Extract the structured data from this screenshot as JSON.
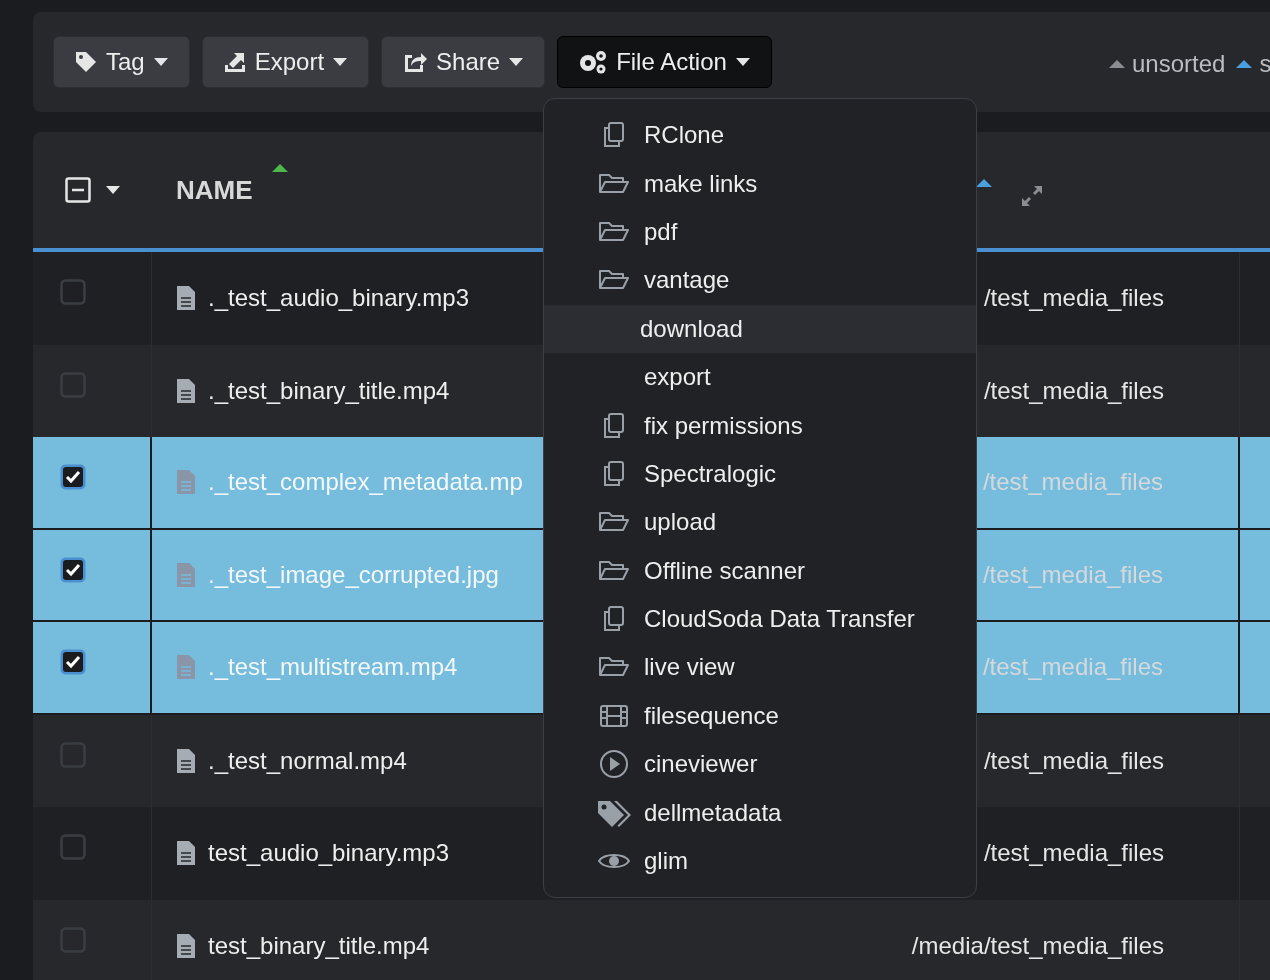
{
  "toolbar": {
    "buttons": [
      {
        "kind": "tag",
        "label": "Tag",
        "open": false
      },
      {
        "kind": "export",
        "label": "Export",
        "open": false
      },
      {
        "kind": "share",
        "label": "Share",
        "open": false
      },
      {
        "kind": "gears",
        "label": "File Action",
        "open": true
      }
    ],
    "sort": [
      {
        "label": "unsorted",
        "active": false
      },
      {
        "label": "s",
        "active": true
      }
    ]
  },
  "table": {
    "select_all": {
      "mixed": true
    },
    "columns": [
      {
        "label": "NAME",
        "sorted": true
      },
      {
        "sorted": true,
        "expand": true
      }
    ],
    "rows": [
      {
        "name": "._test_audio_binary.mp3",
        "path": "/test_media_files",
        "selected": false
      },
      {
        "name": "._test_binary_title.mp4",
        "path": "/test_media_files",
        "selected": false
      },
      {
        "name": "._test_complex_metadata.mp",
        "path": "/test_media_files",
        "selected": true
      },
      {
        "name": "._test_image_corrupted.jpg",
        "path": "/test_media_files",
        "selected": true
      },
      {
        "name": "._test_multistream.mp4",
        "path": "/test_media_files",
        "selected": true
      },
      {
        "name": "._test_normal.mp4",
        "path": "/test_media_files",
        "selected": false
      },
      {
        "name": "test_audio_binary.mp3",
        "path": "/test_media_files",
        "selected": false
      },
      {
        "name": "test_binary_title.mp4",
        "path": "/media/test_media_files",
        "selected": false
      }
    ]
  },
  "menu": {
    "items": [
      {
        "kind": "copy",
        "label": "RClone",
        "highlighted": false
      },
      {
        "kind": "folder",
        "label": "make links",
        "highlighted": false
      },
      {
        "kind": "folder",
        "label": "pdf",
        "highlighted": false
      },
      {
        "kind": "folder",
        "label": "vantage",
        "highlighted": false
      },
      {
        "kind": "plain",
        "label": "download",
        "highlighted": true
      },
      {
        "kind": "plain",
        "label": "export",
        "highlighted": false
      },
      {
        "kind": "copy",
        "label": "fix permissions",
        "highlighted": false
      },
      {
        "kind": "copy",
        "label": "Spectralogic",
        "highlighted": false
      },
      {
        "kind": "folder",
        "label": "upload",
        "highlighted": false
      },
      {
        "kind": "folder",
        "label": "Offline scanner",
        "highlighted": false
      },
      {
        "kind": "copy",
        "label": "CloudSoda Data Transfer",
        "highlighted": false
      },
      {
        "kind": "folder",
        "label": "live view",
        "highlighted": false
      },
      {
        "kind": "film",
        "label": "filesequence",
        "highlighted": false
      },
      {
        "kind": "play",
        "label": "cineviewer",
        "highlighted": false
      },
      {
        "kind": "tags",
        "label": "dellmetadata",
        "highlighted": false
      },
      {
        "kind": "eye",
        "label": "glim",
        "highlighted": false
      }
    ]
  }
}
